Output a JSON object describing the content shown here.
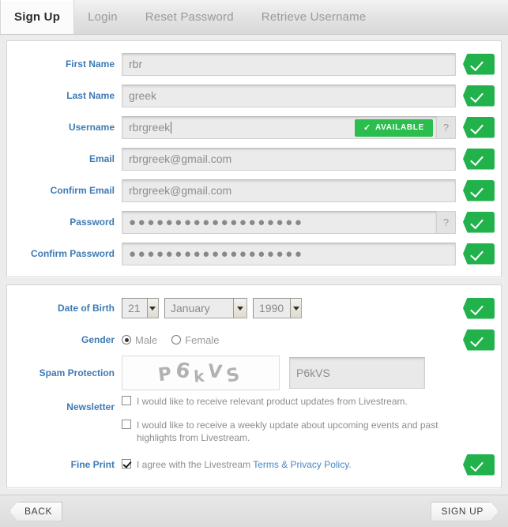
{
  "tabs": [
    {
      "label": "Sign Up",
      "active": true
    },
    {
      "label": "Login",
      "active": false
    },
    {
      "label": "Reset Password",
      "active": false
    },
    {
      "label": "Retrieve Username",
      "active": false
    }
  ],
  "colors": {
    "label_blue": "#3d7ab5",
    "accent_green": "#22b24c",
    "badge_green": "#2bbd4e",
    "link_blue": "#4a86c4",
    "input_bg": "#ebebeb",
    "page_bg": "#ececec"
  },
  "account_panel": {
    "first_name": {
      "label": "First Name",
      "value": "rbr",
      "valid": true
    },
    "last_name": {
      "label": "Last Name",
      "value": "greek",
      "valid": true
    },
    "username": {
      "label": "Username",
      "value": "rbrgreek",
      "availability_badge": "AVAILABLE",
      "availability_check": "✓",
      "help": "?",
      "valid": true
    },
    "email": {
      "label": "Email",
      "value": "rbrgreek@gmail.com",
      "valid": true
    },
    "confirm_email": {
      "label": "Confirm Email",
      "value": "rbrgreek@gmail.com",
      "valid": true
    },
    "password": {
      "label": "Password",
      "value": "●●●●●●●●●●●●●●●●●●●",
      "help": "?",
      "valid": true
    },
    "confirm_password": {
      "label": "Confirm Password",
      "value": "●●●●●●●●●●●●●●●●●●●",
      "valid": true
    }
  },
  "details_panel": {
    "dob": {
      "label": "Date of Birth",
      "day": "21",
      "month": "January",
      "year": "1990",
      "valid": true
    },
    "gender": {
      "label": "Gender",
      "male_label": "Male",
      "female_label": "Female",
      "selected": "Male",
      "valid": true
    },
    "spam_protection": {
      "label": "Spam Protection",
      "captcha_text": "P6kVS",
      "captcha_chars": [
        "P",
        "6",
        "k",
        "V",
        "S"
      ],
      "input_value": "P6kVS"
    },
    "newsletter": {
      "label": "Newsletter",
      "option1": "I would like to receive relevant product updates from Livestream.",
      "option1_checked": false,
      "option2": "I would like to receive a weekly update about upcoming events and past highlights from Livestream.",
      "option2_checked": false
    },
    "fine_print": {
      "label": "Fine Print",
      "text_before": "I agree with the Livestream",
      "link_text": "Terms & Privacy Policy",
      "text_after": ".",
      "checked": true,
      "valid": true
    }
  },
  "footer": {
    "back_label": "BACK",
    "signup_label": "SIGN UP"
  }
}
